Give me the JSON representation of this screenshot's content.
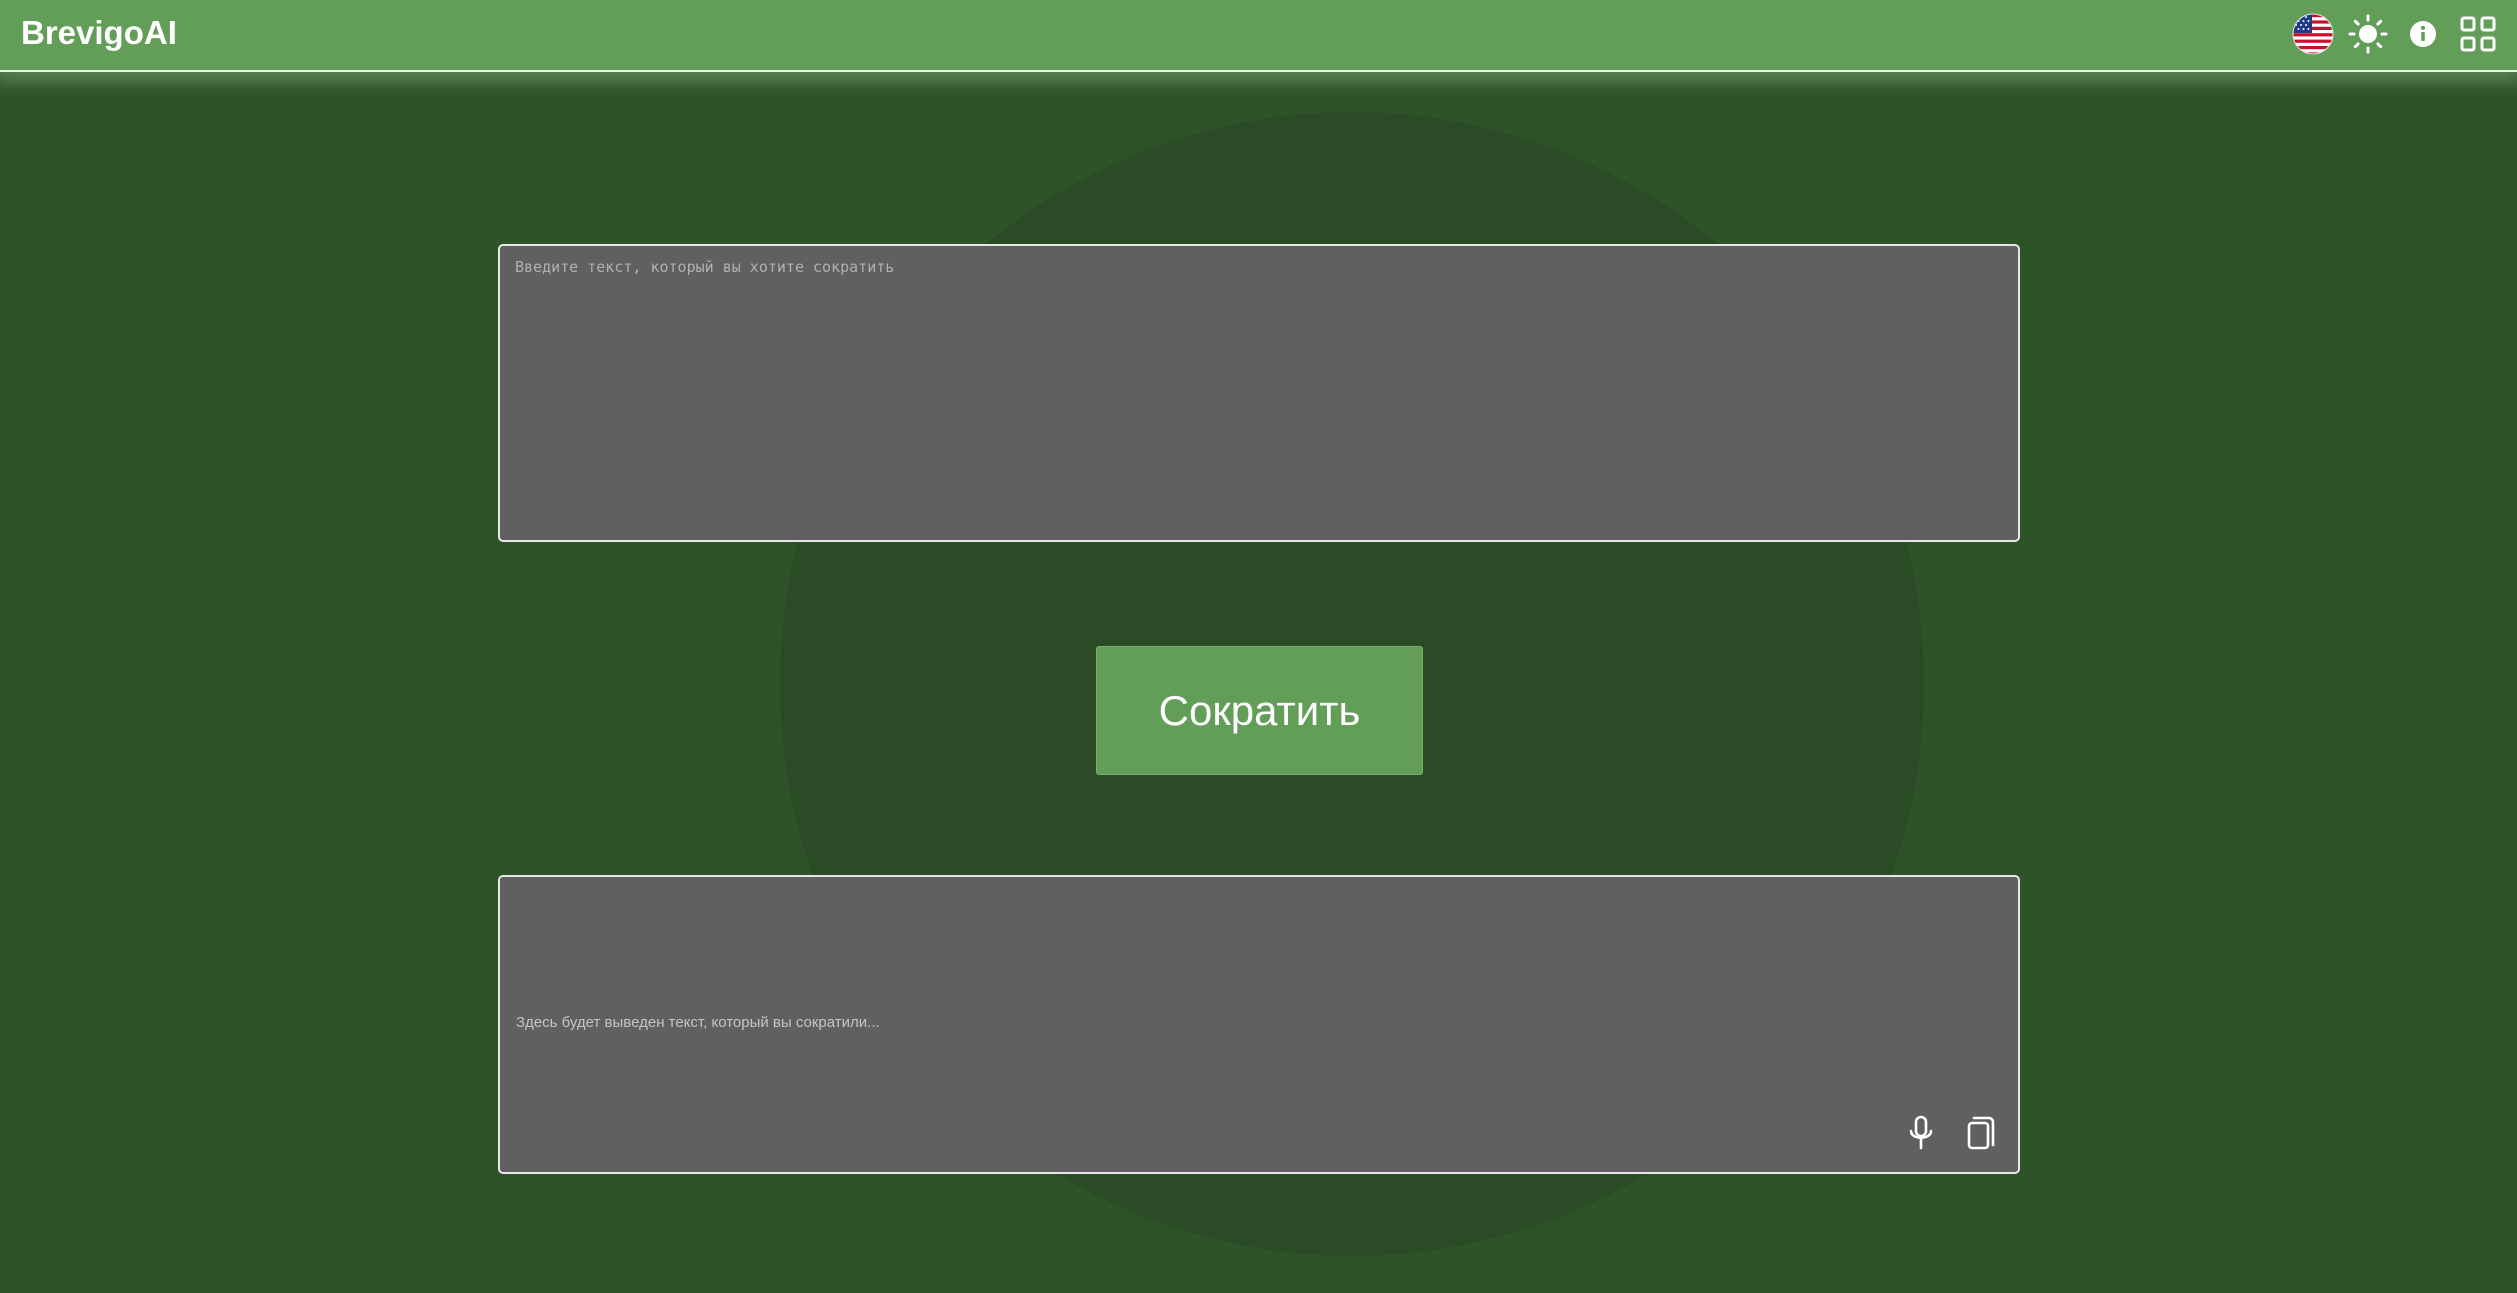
{
  "header": {
    "brand": "BrevigoAI",
    "icons": [
      "us-flag-icon",
      "sun-icon",
      "info-icon",
      "grid-apps-icon"
    ]
  },
  "input": {
    "placeholder": "Введите текст, который вы хотите сократить",
    "value": ""
  },
  "action": {
    "shorten_label": "Сократить"
  },
  "output": {
    "placeholder": "Здесь будет выведен текст, который вы сократили...",
    "icons": [
      "microphone-icon",
      "copy-icon"
    ]
  },
  "colors": {
    "header_bg": "#639e58",
    "page_bg": "#2e5329",
    "circle_bg": "#2b4b27",
    "box_bg": "#606060",
    "button_bg": "#639e58"
  }
}
